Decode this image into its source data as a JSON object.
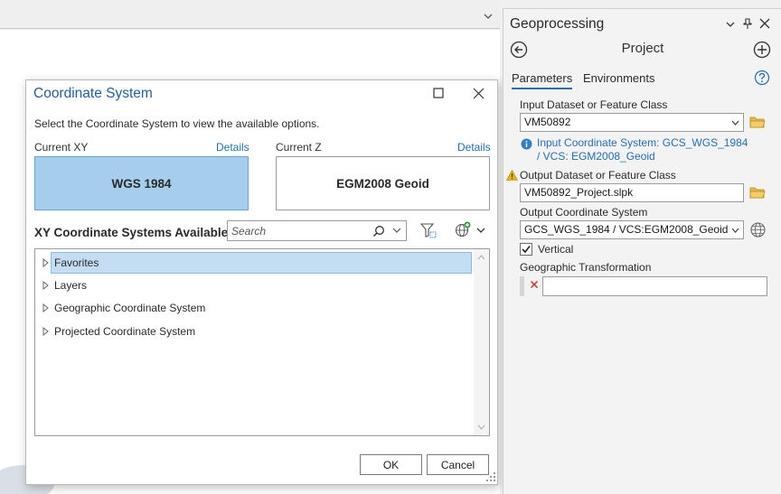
{
  "dialog": {
    "title": "Coordinate System",
    "instructions": "Select the Coordinate System to view the available options.",
    "current_xy_label": "Current XY",
    "current_xy_details": "Details",
    "current_xy_value": "WGS 1984",
    "current_z_label": "Current Z",
    "current_z_details": "Details",
    "current_z_value": "EGM2008 Geoid",
    "available_label": "XY Coordinate Systems Available",
    "search_placeholder": "Search",
    "tree": [
      "Favorites",
      "Layers",
      "Geographic Coordinate System",
      "Projected Coordinate System"
    ],
    "ok_label": "OK",
    "cancel_label": "Cancel"
  },
  "geoprocessing": {
    "title": "Geoprocessing",
    "tool_name": "Project",
    "tabs": [
      "Parameters",
      "Environments"
    ],
    "input_label": "Input Dataset or Feature Class",
    "input_value": "VM50892",
    "info_text": "Input Coordinate System: GCS_WGS_1984 / VCS: EGM2008_Geoid",
    "output_label": "Output Dataset or Feature Class",
    "output_value": "VM50892_Project.slpk",
    "ocs_label": "Output Coordinate System",
    "ocs_value": "GCS_WGS_1984 / VCS:EGM2008_Geoid",
    "vertical_label": "Vertical",
    "vertical_checked": true,
    "gt_label": "Geographic Transformation",
    "gt_value": ""
  },
  "colors": {
    "accent": "#1f6fb8",
    "selection": "#a6cdec",
    "folder": "#e8b84a",
    "warning": "#f0b400",
    "error_x": "#c0392b"
  }
}
